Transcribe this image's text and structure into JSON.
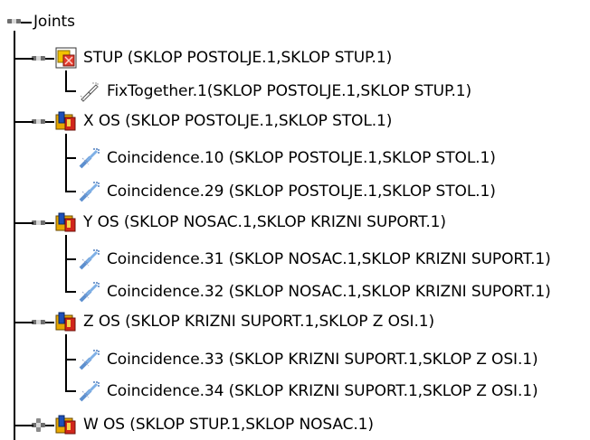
{
  "tree": {
    "root": {
      "label": "Joints",
      "icon": "tree-node-icon"
    },
    "joints": [
      {
        "label": "STUP (SKLOP POSTOLJE.1,SKLOP STUP.1)",
        "icon": "rigid-joint-icon",
        "expanded": true,
        "constraints": [
          {
            "label": "FixTogether.1(SKLOP POSTOLJE.1,SKLOP STUP.1)",
            "icon": "fix-together-icon"
          }
        ]
      },
      {
        "label": "X OS (SKLOP POSTOLJE.1,SKLOP STOL.1)",
        "icon": "prismatic-joint-icon",
        "expanded": true,
        "constraints": [
          {
            "label": "Coincidence.10 (SKLOP POSTOLJE.1,SKLOP STOL.1)",
            "icon": "coincidence-constraint-icon"
          },
          {
            "label": "Coincidence.29 (SKLOP POSTOLJE.1,SKLOP STOL.1)",
            "icon": "coincidence-constraint-icon"
          }
        ]
      },
      {
        "label": "Y OS (SKLOP NOSAC.1,SKLOP KRIZNI SUPORT.1)",
        "icon": "prismatic-joint-icon",
        "expanded": true,
        "constraints": [
          {
            "label": "Coincidence.31 (SKLOP NOSAC.1,SKLOP KRIZNI SUPORT.1)",
            "icon": "coincidence-constraint-icon"
          },
          {
            "label": "Coincidence.32 (SKLOP NOSAC.1,SKLOP KRIZNI SUPORT.1)",
            "icon": "coincidence-constraint-icon"
          }
        ]
      },
      {
        "label": "Z OS (SKLOP KRIZNI SUPORT.1,SKLOP Z OSI.1)",
        "icon": "prismatic-joint-icon",
        "expanded": true,
        "constraints": [
          {
            "label": "Coincidence.33 (SKLOP KRIZNI SUPORT.1,SKLOP Z OSI.1)",
            "icon": "coincidence-constraint-icon"
          },
          {
            "label": "Coincidence.34 (SKLOP KRIZNI SUPORT.1,SKLOP Z OSI.1)",
            "icon": "coincidence-constraint-icon"
          }
        ]
      },
      {
        "label": "W OS (SKLOP STUP.1,SKLOP NOSAC.1)",
        "icon": "prismatic-joint-icon",
        "expanded": false,
        "constraints": []
      }
    ]
  }
}
